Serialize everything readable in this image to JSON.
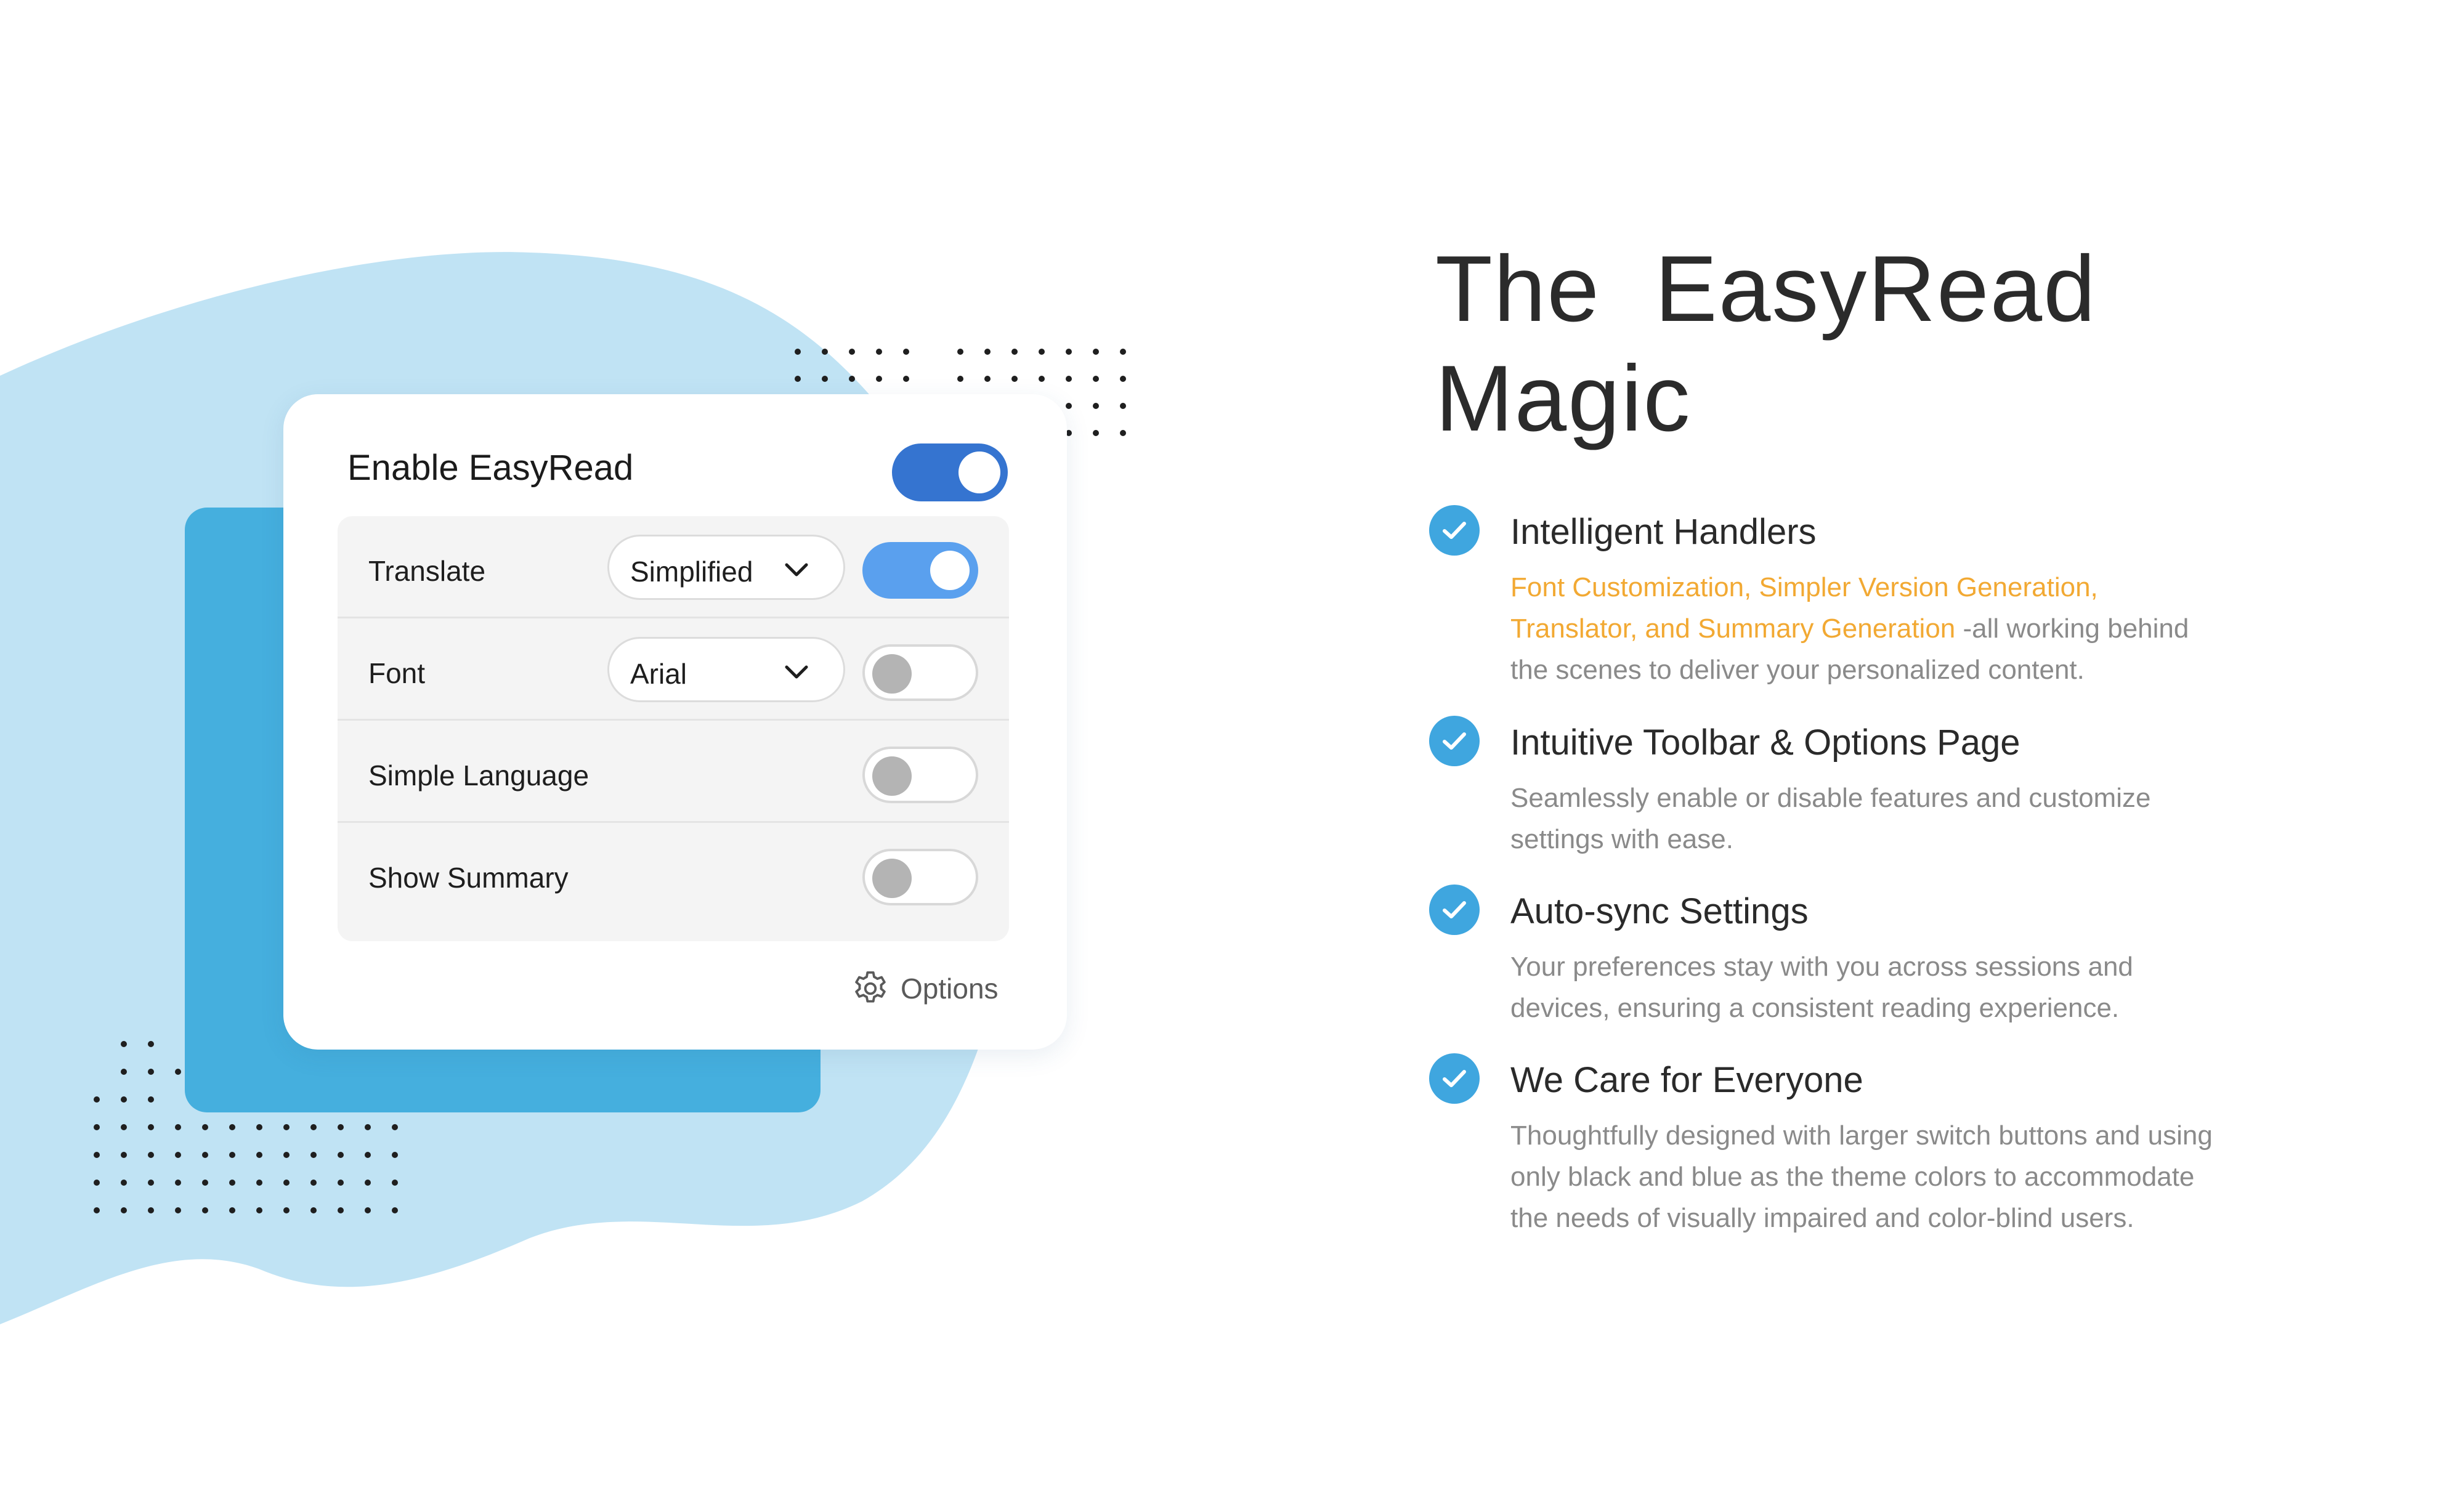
{
  "panel": {
    "title": "Enable EasyRead",
    "master_enabled": true,
    "rows": [
      {
        "label": "Translate",
        "select_value": "Simplified",
        "enabled": true
      },
      {
        "label": "Font",
        "select_value": "Arial",
        "enabled": false
      },
      {
        "label": "Simple Language",
        "enabled": false
      },
      {
        "label": "Show Summary",
        "enabled": false
      }
    ],
    "options_label": "Options"
  },
  "heading": {
    "line1": "The  EasyRead",
    "line2": "Magic"
  },
  "features": [
    {
      "title": "Intelligent Handlers",
      "highlight": "Font Customization, Simpler Version Generation, Translator, and Summary Generation",
      "desc": " -all working behind the scenes to deliver your personalized content."
    },
    {
      "title": "Intuitive Toolbar & Options Page",
      "desc": "Seamlessly enable or disable features and customize settings with ease."
    },
    {
      "title": "Auto-sync Settings",
      "desc": "Your preferences stay with you across sessions and devices, ensuring a consistent reading experience."
    },
    {
      "title": "We Care for Everyone",
      "desc": "Thoughtfully designed with larger switch buttons and using only black and blue as the theme colors to accommodate the needs of visually impaired and color-blind users."
    }
  ],
  "colors": {
    "blob": "#c0e3f4",
    "back_card": "#45afde",
    "master_toggle": "#3574d0",
    "row_toggle_on": "#5aa0ee",
    "check": "#3fa6df",
    "highlight": "#f2a933"
  },
  "icons": {
    "chevron": "chevron-down-icon",
    "gear": "gear-icon",
    "check": "check-circle-icon"
  }
}
